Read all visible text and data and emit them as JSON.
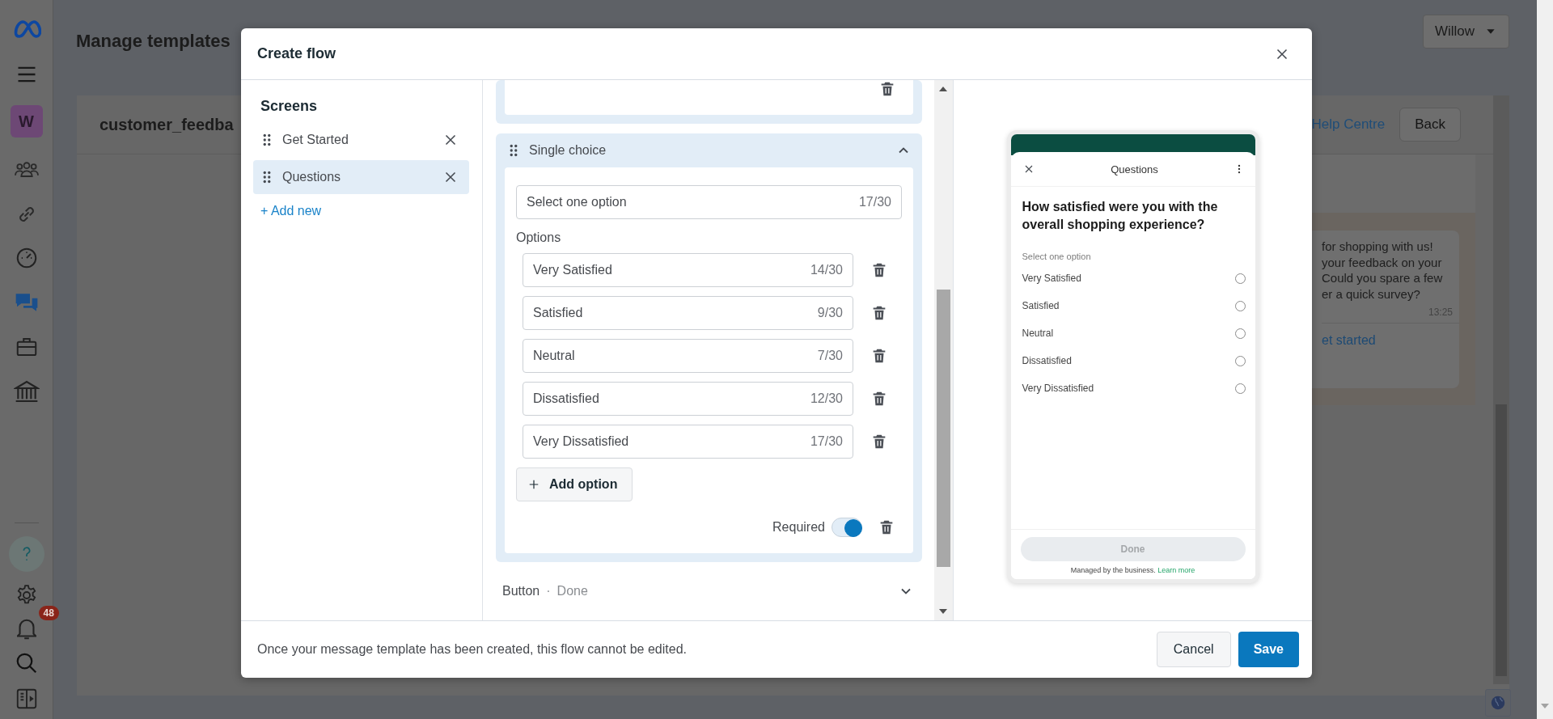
{
  "rail": {
    "workspace_initial": "W",
    "notification_count": "48"
  },
  "page": {
    "title": "Manage templates",
    "account": "Willow",
    "template_name": "customer_feedba",
    "help_link": "Help Centre",
    "back_button": "Back",
    "chat_bubble": {
      "lines": [
        "for shopping with us!",
        "your feedback on your",
        "Could you spare a few",
        "er a quick survey?"
      ],
      "time": "13:25",
      "action": "et started"
    }
  },
  "modal": {
    "title": "Create flow",
    "screens": {
      "heading": "Screens",
      "items": [
        {
          "label": "Get Started",
          "selected": false
        },
        {
          "label": "Questions",
          "selected": true
        }
      ],
      "add_new": "+ Add new"
    },
    "editor": {
      "component": {
        "title": "Single choice",
        "expanded": true,
        "label_field": {
          "value": "Select one option",
          "count": "17/30"
        },
        "options_label": "Options",
        "options": [
          {
            "value": "Very Satisfied",
            "count": "14/30"
          },
          {
            "value": "Satisfied",
            "count": "9/30"
          },
          {
            "value": "Neutral",
            "count": "7/30"
          },
          {
            "value": "Dissatisfied",
            "count": "12/30"
          },
          {
            "value": "Very Dissatisfied",
            "count": "17/30"
          }
        ],
        "add_option": "Add option",
        "required": {
          "label": "Required",
          "on": true
        }
      },
      "button_row": {
        "label": "Button",
        "separator": "·",
        "value": "Done",
        "expanded": false
      }
    },
    "preview": {
      "title": "Questions",
      "question": "How satisfied were you with the overall shopping experience?",
      "hint": "Select one option",
      "options": [
        {
          "label": "Very Satisfied",
          "selected": false
        },
        {
          "label": "Satisfied",
          "selected": false
        },
        {
          "label": "Neutral",
          "selected": false
        },
        {
          "label": "Dissatisfied",
          "selected": false
        },
        {
          "label": "Very Dissatisfied",
          "selected": false
        }
      ],
      "button": "Done",
      "footer": "Managed by the business.",
      "footer_link": "Learn more"
    },
    "footer_note": "Once your message template has been created, this flow cannot be edited.",
    "buttons": {
      "cancel": "Cancel",
      "save": "Save"
    }
  }
}
